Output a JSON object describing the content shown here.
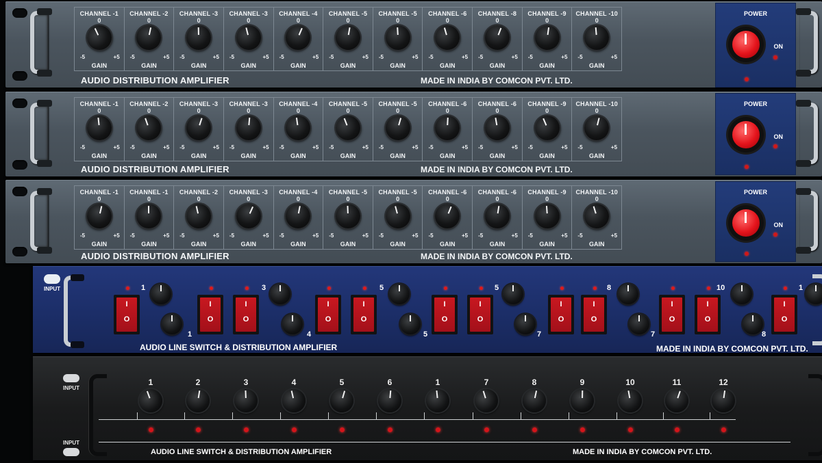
{
  "grey_units": [
    {
      "channels": [
        "CHANNEL -1",
        "CHANNEL -2",
        "CHANNEL -3",
        "CHANNEL -3",
        "CHANNEL -4",
        "CHANNEL -5",
        "CHANNEL -5",
        "CHANNEL -6",
        "CHANNEL -8",
        "CHANNEL -9",
        "CHANNEL -10"
      ],
      "title": "AUDIO DISTRIBUTION AMPLIFIER",
      "made": "MADE IN INDIA BY COMCON PVT. LTD."
    },
    {
      "channels": [
        "CHANNEL -1",
        "CHANNEL -2",
        "CHANNEL -3",
        "CHANNEL -3",
        "CHANNEL -4",
        "CHANNEL -5",
        "CHANNEL -5",
        "CHANNEL -6",
        "CHANNEL -6",
        "CHANNEL -9",
        "CHANNEL -10"
      ],
      "title": "AUDIO DISTRIBUTION AMPLIFIER",
      "made": "MADE IN INDIA BY COMCON PVT. LTD."
    },
    {
      "channels": [
        "CHANNEL -1",
        "CHANNEL -1",
        "CHANNEL -2",
        "CHANNEL -3",
        "CHANNEL -4",
        "CHANNEL -5",
        "CHANNEL -5",
        "CHANNEL -6",
        "CHANNEL -6",
        "CHANNEL -9",
        "CHANNEL -10"
      ],
      "title": "AUDIO DISTRIBUTION AMPLIFIER",
      "made": "MADE IN INDIA BY COMCON PVT. LTD."
    }
  ],
  "knob_scale": {
    "zero": "0",
    "minus": "-5",
    "plus": "+5",
    "gain": "GAIN"
  },
  "power": {
    "label": "POWER",
    "on": "ON"
  },
  "blue_unit": {
    "input": "INPUT",
    "title": "AUDIO LINE SWITCH & DISTRIBUTION AMPLIFIER",
    "made": "MADE IN INDIA BY COMCON PVT. LTD.",
    "switch_on": "I",
    "switch_off": "O",
    "top_numbers": [
      "1",
      "3",
      "5",
      "5",
      "8",
      "10",
      "1"
    ],
    "bottom_numbers": [
      "1",
      "4",
      "5",
      "7",
      "7",
      "8"
    ]
  },
  "black_unit": {
    "input_top": "INPUT",
    "input_bottom": "INPUT",
    "title": "AUDIO LINE SWITCH & DISTRIBUTION AMPLIFIER",
    "made": "MADE IN INDIA BY COMCON PVT. LTD.",
    "channels": [
      "1",
      "2",
      "3",
      "4",
      "5",
      "6",
      "1",
      "7",
      "8",
      "9",
      "10",
      "11",
      "12"
    ]
  }
}
